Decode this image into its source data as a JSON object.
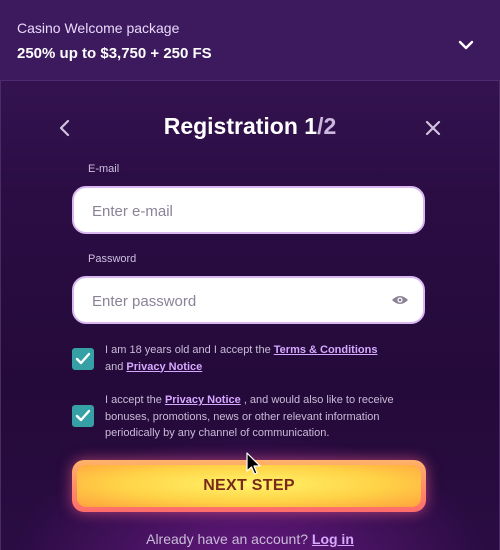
{
  "promo": {
    "label": "Casino Welcome package",
    "value": "250% up to $3,750 + 250 FS",
    "toggle_icon": "chevron-down-icon"
  },
  "modal": {
    "back_icon": "chevron-left-icon",
    "close_icon": "close-icon",
    "title_main": "Registration 1",
    "title_step": "/2"
  },
  "form": {
    "email": {
      "label": "E-mail",
      "placeholder": "Enter e-mail",
      "value": ""
    },
    "password": {
      "label": "Password",
      "placeholder": "Enter password",
      "value": "",
      "reveal_icon": "eye-icon"
    }
  },
  "consents": [
    {
      "checked": true,
      "text_before": "I am 18 years old and I accept the ",
      "link1": "Terms & Conditions",
      "text_mid": " and ",
      "link2": "Privacy Notice"
    },
    {
      "checked": true,
      "text_before": "I accept the ",
      "link1": "Privacy Notice",
      "text_after": " , and would also like to receive bonuses, promotions, news or other relevant information periodically by any channel of communication."
    }
  ],
  "cta": {
    "label": "NEXT STEP"
  },
  "footer": {
    "text": "Already have an account? ",
    "link": "Log in"
  },
  "colors": {
    "background": "#2b0d44",
    "promo_bar": "#3d1a5e",
    "checkbox": "#35a0a5",
    "link": "#d6a9ff",
    "cta_yellow": "#ffd246",
    "cta_text": "#7a2a1a"
  }
}
